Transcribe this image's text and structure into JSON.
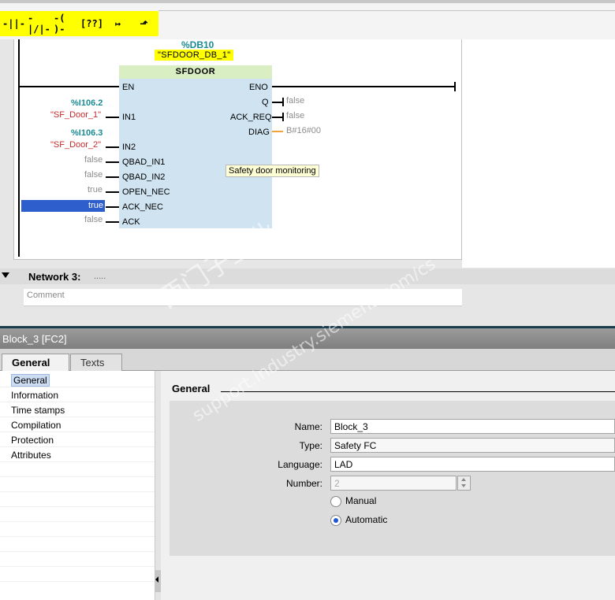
{
  "toolbar": {
    "buttons": [
      {
        "icon": "no-contact-icon",
        "glyph": "-||-"
      },
      {
        "icon": "nc-contact-icon",
        "glyph": "-|/|-"
      },
      {
        "icon": "coil-icon",
        "glyph": "-( )-"
      },
      {
        "icon": "empty-box-icon",
        "glyph": "[??]"
      },
      {
        "icon": "open-branch-icon",
        "glyph": "↦"
      },
      {
        "icon": "close-branch-icon",
        "glyph": "⬏"
      }
    ]
  },
  "network": {
    "instance_address": "%DB10",
    "instance_name": "\"SFDOOR_DB_1\"",
    "block_title": "SFDOOR",
    "tooltip": "Safety door monitoring",
    "inputs": [
      {
        "pin": "EN"
      },
      {
        "pin": "IN1",
        "address": "%I106.2",
        "symbol": "\"SF_Door_1\""
      },
      {
        "pin": "IN2",
        "address": "%I106.3",
        "symbol": "\"SF_Door_2\""
      },
      {
        "pin": "QBAD_IN1",
        "value": "false"
      },
      {
        "pin": "QBAD_IN2",
        "value": "false"
      },
      {
        "pin": "OPEN_NEC",
        "value": "true"
      },
      {
        "pin": "ACK_NEC",
        "value": "true"
      },
      {
        "pin": "ACK",
        "value": "false"
      }
    ],
    "outputs": [
      {
        "pin": "ENO"
      },
      {
        "pin": "Q",
        "value": "false"
      },
      {
        "pin": "ACK_REQ",
        "value": "false"
      },
      {
        "pin": "DIAG",
        "value": "B#16#00"
      }
    ]
  },
  "network3": {
    "title": "Network 3:",
    "dots": ".....",
    "comment_placeholder": "Comment"
  },
  "properties": {
    "title": "Block_3 [FC2]",
    "tabs": [
      "General",
      "Texts"
    ],
    "nav": [
      "General",
      "Information",
      "Time stamps",
      "Compilation",
      "Protection",
      "Attributes"
    ],
    "section_title": "General",
    "fields": {
      "name_label": "Name:",
      "name_value": "Block_3",
      "type_label": "Type:",
      "type_value": "Safety FC",
      "language_label": "Language:",
      "language_value": "LAD",
      "number_label": "Number:",
      "number_value": "2"
    },
    "radios": {
      "manual": "Manual",
      "automatic": "Automatic"
    }
  },
  "watermark": {
    "line1": "西门子工业  技术论坛",
    "line2": "support.industry.siemens.com/cs"
  },
  "colors": {
    "toolbar_yellow": "#ffff00",
    "fb_blue": "#cfe3f1",
    "fb_title_green": "#d9eec3",
    "address_teal": "#1b8b94",
    "symbol_red": "#c22b2b",
    "selection_blue": "#2e5dcc",
    "diag_orange": "#f4a235"
  }
}
